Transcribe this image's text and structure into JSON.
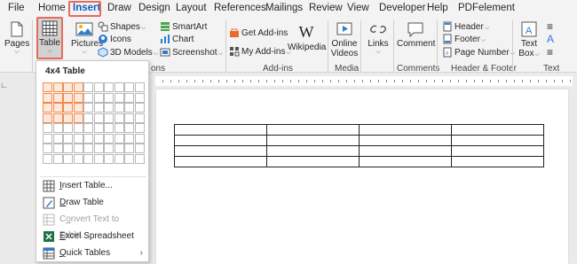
{
  "tabs": [
    {
      "label": "File"
    },
    {
      "label": "Home"
    },
    {
      "label": "Insert"
    },
    {
      "label": "Draw"
    },
    {
      "label": "Design"
    },
    {
      "label": "Layout"
    },
    {
      "label": "References"
    },
    {
      "label": "Mailings"
    },
    {
      "label": "Review"
    },
    {
      "label": "View"
    },
    {
      "label": "Developer"
    },
    {
      "label": "Help"
    },
    {
      "label": "PDFelement"
    }
  ],
  "active_tab": "Insert",
  "ribbon": {
    "pages": "Pages",
    "table": "Table",
    "pictures": "Pictures",
    "shapes": "Shapes",
    "icons": "Icons",
    "models_3d": "3D Models",
    "smartart": "SmartArt",
    "chart": "Chart",
    "screenshot": "Screenshot",
    "group_illustrations": "ons",
    "get_addins": "Get Add-ins",
    "my_addins": "My Add-ins",
    "wikipedia": "Wikipedia",
    "group_addins": "Add-ins",
    "online_videos_line1": "Online",
    "online_videos_line2": "Videos",
    "group_media": "Media",
    "links": "Links",
    "comment": "Comment",
    "group_comments": "Comments",
    "header": "Header",
    "footer": "Footer",
    "page_number": "Page Number",
    "group_header_footer": "Header & Footer",
    "text_box_line1": "Text",
    "text_box_line2": "Box",
    "group_text": "Text"
  },
  "dropdown": {
    "title": "4x4 Table",
    "grid_cols": 10,
    "grid_rows": 8,
    "selected_cols": 4,
    "selected_rows": 4,
    "items": [
      {
        "label": "Insert Table...",
        "enabled": true
      },
      {
        "label": "Draw Table",
        "enabled": true
      },
      {
        "label": "Convert Text to Table...",
        "enabled": false
      },
      {
        "label": "Excel Spreadsheet",
        "enabled": true
      },
      {
        "label": "Quick Tables",
        "enabled": true
      }
    ]
  },
  "document_table": {
    "rows": 4,
    "cols": 4
  }
}
